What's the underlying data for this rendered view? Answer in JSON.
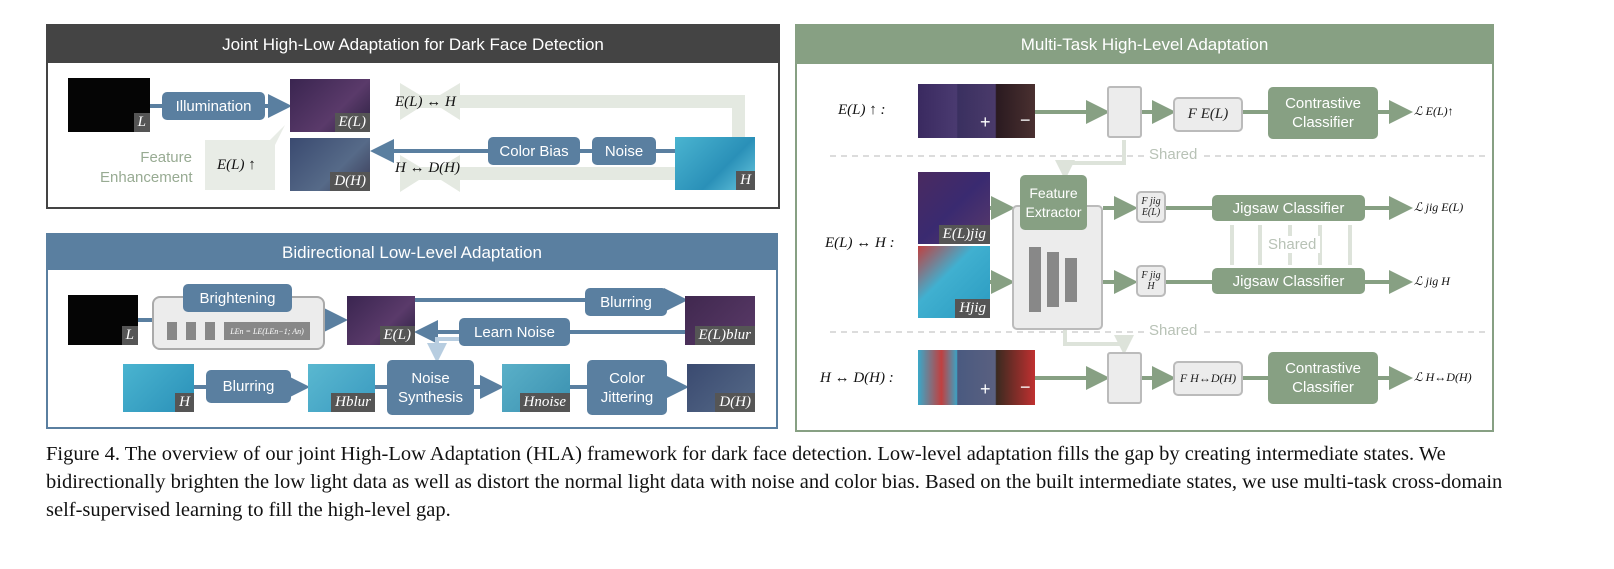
{
  "panel_joint": {
    "title": "Joint High-Low Adaptation for Dark Face Detection",
    "illumination": "Illumination",
    "color_bias": "Color Bias",
    "noise": "Noise",
    "feature_enhancement": "Feature Enhancement",
    "el_up": "E(L) ↑",
    "el_h": "E(L) ↔ H",
    "h_dh": "H ↔ D(H)",
    "img_L": "L",
    "img_EL": "E(L)",
    "img_DH": "D(H)",
    "img_H": "H"
  },
  "panel_low": {
    "title": "Bidirectional Low-Level Adaptation",
    "brightening": "Brightening",
    "formula": "LEn = LE(LEn−1; An)",
    "blurring_top": "Blurring",
    "learn_noise": "Learn Noise",
    "blurring_bottom": "Blurring",
    "noise_synthesis": "Noise Synthesis",
    "color_jittering": "Color Jittering",
    "img_L": "L",
    "img_EL": "E(L)",
    "img_ELblur": "E(L)blur",
    "img_H": "H",
    "img_Hblur": "Hblur",
    "img_Hnoise": "Hnoise",
    "img_DH": "D(H)"
  },
  "panel_high": {
    "title": "Multi-Task High-Level Adaptation",
    "row1_label": "E(L) ↑ :",
    "row2_label": "E(L) ↔ H :",
    "row3_label": "H ↔ D(H) :",
    "feature_extractor": "Feature Extractor",
    "contrastive_1": "Contrastive Classifier",
    "contrastive_2": "Contrastive Classifier",
    "jigsaw_1": "Jigsaw Classifier",
    "jigsaw_2": "Jigsaw Classifier",
    "shared_1": "Shared",
    "shared_2": "Shared",
    "shared_3": "Shared",
    "f_el": "F E(L)",
    "f_jig_el": "F jig E(L)",
    "f_jig_h": "F jig H",
    "f_hdh": "F H↔D(H)",
    "loss_el": "ℒ E(L)↑",
    "loss_jig_el": "ℒ jig E(L)",
    "loss_jig_h": "ℒ jig H",
    "loss_hdh": "ℒ H↔D(H)",
    "img_ELjig": "E(L)jig",
    "img_Hjig": "Hjig",
    "plus": "+",
    "minus": "−"
  },
  "caption": "Figure 4. The overview of our joint High-Low Adaptation (HLA) framework for dark face detection. Low-level adaptation fills the gap by creating intermediate states. We bidirectionally brighten the low light data as well as distort the normal light data with noise and color bias. Based on the built intermediate states, we use multi-task cross-domain self-supervised learning to fill the high-level gap.",
  "colors": {
    "dark_header": "#444444",
    "blue": "#5a7fa0",
    "green": "#87a083",
    "light_arrow": "#e3e8e0"
  }
}
